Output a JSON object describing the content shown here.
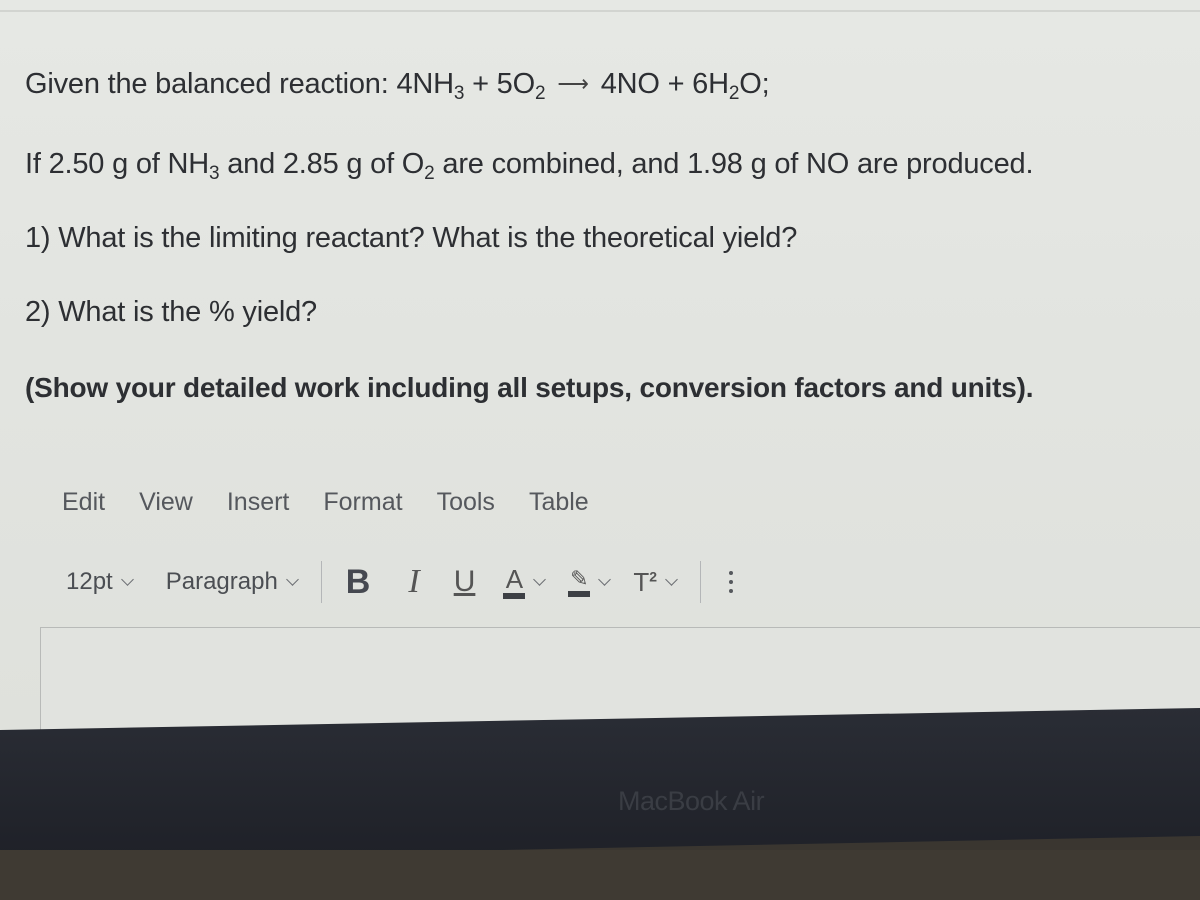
{
  "question": {
    "line1": {
      "prefix": "Given the balanced reaction: 4NH",
      "sub1": "3",
      "mid1": " + 5O",
      "sub2": "2",
      "arrow": "⟶",
      "mid2": "4NO + 6H",
      "sub3": "2",
      "suffix": "O;"
    },
    "line2": {
      "prefix": "If 2.50 g of NH",
      "sub1": "3",
      "mid1": " and 2.85 g of O",
      "sub2": "2",
      "suffix": " are combined, and 1.98 g of NO are produced."
    },
    "line3": "1) What is the limiting reactant? What is the theoretical yield?",
    "line4": "2) What is the % yield?",
    "line5": "(Show your detailed work including all setups, conversion factors and units)."
  },
  "menubar": {
    "items": [
      "Edit",
      "View",
      "Insert",
      "Format",
      "Tools",
      "Table"
    ]
  },
  "toolbar": {
    "font_size": "12pt",
    "block_format": "Paragraph",
    "bold": "B",
    "italic": "I",
    "underline": "U",
    "text_color": "A",
    "highlight_icon": "✎",
    "superscript_base": "T",
    "superscript_exp": "2"
  },
  "editor": {
    "content": ""
  },
  "device": {
    "label": "MacBook Air"
  }
}
